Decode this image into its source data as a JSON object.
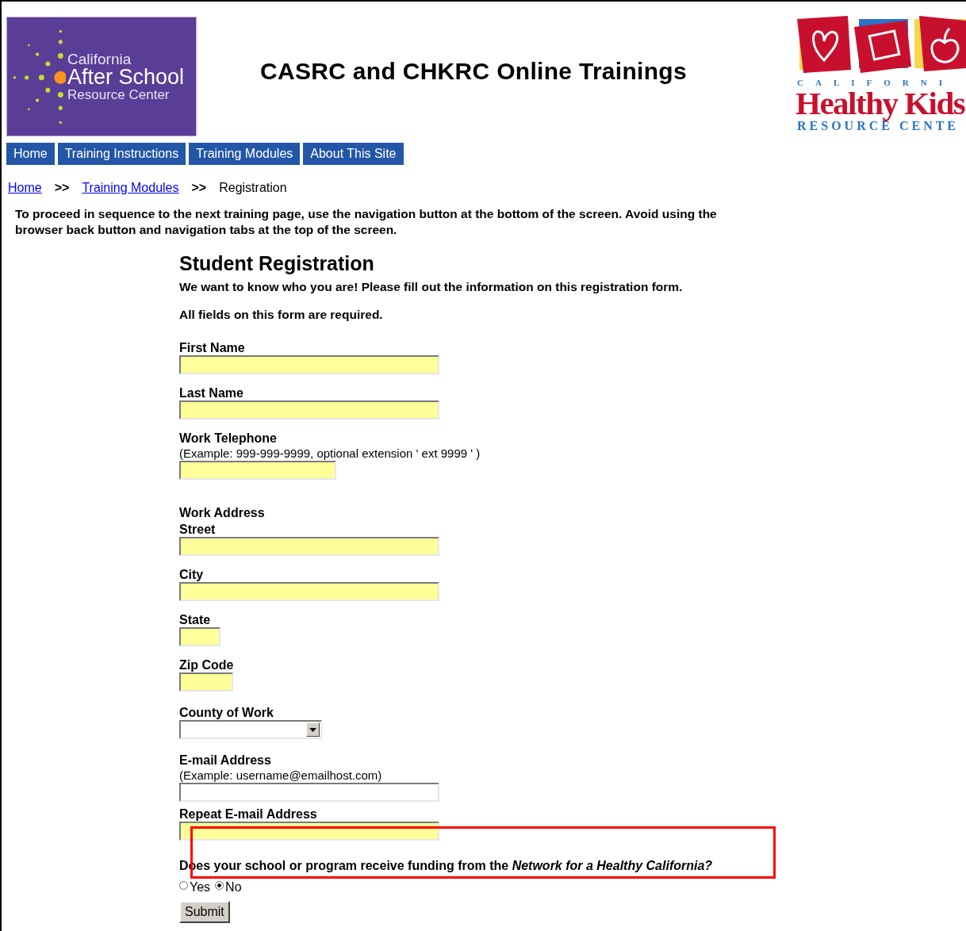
{
  "left_logo": {
    "lines": [
      "California",
      "After School",
      "Resource Center"
    ]
  },
  "page_title": "CASRC and CHKRC Online Trainings",
  "right_logo": {
    "top": "CALIFORNI",
    "name": "Healthy Kids",
    "bottom": "RESOURCE CENTE"
  },
  "nav_tabs": [
    "Home",
    "Training Instructions",
    "Training Modules",
    "About This Site"
  ],
  "breadcrumb": [
    {
      "label": "Home",
      "kind": "link"
    },
    {
      "label": ">>",
      "kind": "separator"
    },
    {
      "label": "Training Modules",
      "kind": "link"
    },
    {
      "label": ">>",
      "kind": "separator"
    },
    {
      "label": "Registration",
      "kind": "current"
    }
  ],
  "notice": "To proceed in sequence to the next training page, use the navigation button at the bottom of the screen. Avoid using the browser back button and navigation tabs at the top of the screen.",
  "form": {
    "title": "Student Registration",
    "intro": "We want to know who you are! Please fill out the information on this registration form.",
    "required_note": "All fields on this form are required.",
    "fields": [
      {
        "kind": "text",
        "label": "First Name",
        "highlighted": true
      },
      {
        "kind": "text",
        "label": "Last Name",
        "highlighted": true
      },
      {
        "kind": "text",
        "label": "Work Telephone",
        "hint": "(Example: 999-999-9999, optional extension ' ext 9999 ' )",
        "highlighted": true
      },
      {
        "kind": "heading",
        "label": "Work Address"
      },
      {
        "kind": "text",
        "label": "Street",
        "highlighted": true
      },
      {
        "kind": "text",
        "label": "City",
        "highlighted": true
      },
      {
        "kind": "text",
        "label": "State",
        "highlighted": true
      },
      {
        "kind": "text",
        "label": "Zip Code",
        "highlighted": true
      },
      {
        "kind": "select",
        "label": "County of Work"
      },
      {
        "kind": "text",
        "label": "E-mail Address",
        "hint": "(Example: username@emailhost.com)",
        "highlighted": false
      },
      {
        "kind": "text",
        "label": "Repeat E-mail Address",
        "highlighted": true
      }
    ],
    "question": "Does your school or program receive funding from the *Network for a Healthy California?*",
    "options": [
      {
        "label": "Yes",
        "selected": false
      },
      {
        "label": "No",
        "selected": true
      }
    ],
    "submit": "Submit"
  },
  "annotation": {
    "kind": "box"
  }
}
